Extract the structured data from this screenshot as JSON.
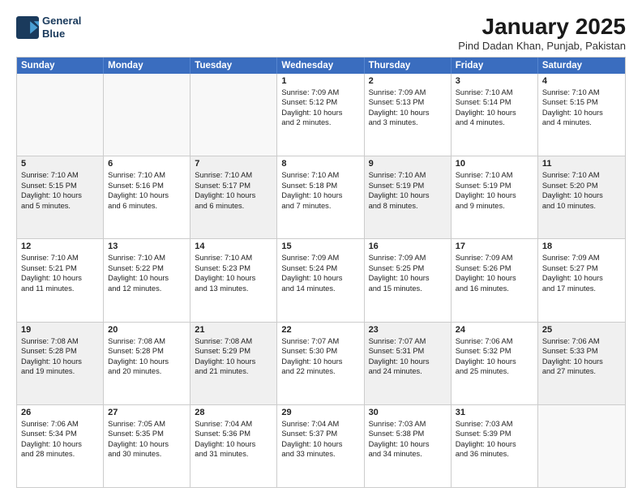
{
  "logo": {
    "line1": "General",
    "line2": "Blue"
  },
  "title": "January 2025",
  "location": "Pind Dadan Khan, Punjab, Pakistan",
  "header": {
    "days": [
      "Sunday",
      "Monday",
      "Tuesday",
      "Wednesday",
      "Thursday",
      "Friday",
      "Saturday"
    ]
  },
  "rows": [
    {
      "cells": [
        {
          "empty": true
        },
        {
          "empty": true
        },
        {
          "empty": true
        },
        {
          "num": "1",
          "lines": [
            "Sunrise: 7:09 AM",
            "Sunset: 5:12 PM",
            "Daylight: 10 hours",
            "and 2 minutes."
          ]
        },
        {
          "num": "2",
          "lines": [
            "Sunrise: 7:09 AM",
            "Sunset: 5:13 PM",
            "Daylight: 10 hours",
            "and 3 minutes."
          ]
        },
        {
          "num": "3",
          "lines": [
            "Sunrise: 7:10 AM",
            "Sunset: 5:14 PM",
            "Daylight: 10 hours",
            "and 4 minutes."
          ]
        },
        {
          "num": "4",
          "lines": [
            "Sunrise: 7:10 AM",
            "Sunset: 5:15 PM",
            "Daylight: 10 hours",
            "and 4 minutes."
          ]
        }
      ]
    },
    {
      "cells": [
        {
          "num": "5",
          "shaded": true,
          "lines": [
            "Sunrise: 7:10 AM",
            "Sunset: 5:15 PM",
            "Daylight: 10 hours",
            "and 5 minutes."
          ]
        },
        {
          "num": "6",
          "lines": [
            "Sunrise: 7:10 AM",
            "Sunset: 5:16 PM",
            "Daylight: 10 hours",
            "and 6 minutes."
          ]
        },
        {
          "num": "7",
          "shaded": true,
          "lines": [
            "Sunrise: 7:10 AM",
            "Sunset: 5:17 PM",
            "Daylight: 10 hours",
            "and 6 minutes."
          ]
        },
        {
          "num": "8",
          "lines": [
            "Sunrise: 7:10 AM",
            "Sunset: 5:18 PM",
            "Daylight: 10 hours",
            "and 7 minutes."
          ]
        },
        {
          "num": "9",
          "shaded": true,
          "lines": [
            "Sunrise: 7:10 AM",
            "Sunset: 5:19 PM",
            "Daylight: 10 hours",
            "and 8 minutes."
          ]
        },
        {
          "num": "10",
          "lines": [
            "Sunrise: 7:10 AM",
            "Sunset: 5:19 PM",
            "Daylight: 10 hours",
            "and 9 minutes."
          ]
        },
        {
          "num": "11",
          "shaded": true,
          "lines": [
            "Sunrise: 7:10 AM",
            "Sunset: 5:20 PM",
            "Daylight: 10 hours",
            "and 10 minutes."
          ]
        }
      ]
    },
    {
      "cells": [
        {
          "num": "12",
          "lines": [
            "Sunrise: 7:10 AM",
            "Sunset: 5:21 PM",
            "Daylight: 10 hours",
            "and 11 minutes."
          ]
        },
        {
          "num": "13",
          "shaded": false,
          "lines": [
            "Sunrise: 7:10 AM",
            "Sunset: 5:22 PM",
            "Daylight: 10 hours",
            "and 12 minutes."
          ]
        },
        {
          "num": "14",
          "lines": [
            "Sunrise: 7:10 AM",
            "Sunset: 5:23 PM",
            "Daylight: 10 hours",
            "and 13 minutes."
          ]
        },
        {
          "num": "15",
          "shaded": false,
          "lines": [
            "Sunrise: 7:09 AM",
            "Sunset: 5:24 PM",
            "Daylight: 10 hours",
            "and 14 minutes."
          ]
        },
        {
          "num": "16",
          "lines": [
            "Sunrise: 7:09 AM",
            "Sunset: 5:25 PM",
            "Daylight: 10 hours",
            "and 15 minutes."
          ]
        },
        {
          "num": "17",
          "shaded": false,
          "lines": [
            "Sunrise: 7:09 AM",
            "Sunset: 5:26 PM",
            "Daylight: 10 hours",
            "and 16 minutes."
          ]
        },
        {
          "num": "18",
          "lines": [
            "Sunrise: 7:09 AM",
            "Sunset: 5:27 PM",
            "Daylight: 10 hours",
            "and 17 minutes."
          ]
        }
      ]
    },
    {
      "cells": [
        {
          "num": "19",
          "shaded": true,
          "lines": [
            "Sunrise: 7:08 AM",
            "Sunset: 5:28 PM",
            "Daylight: 10 hours",
            "and 19 minutes."
          ]
        },
        {
          "num": "20",
          "lines": [
            "Sunrise: 7:08 AM",
            "Sunset: 5:28 PM",
            "Daylight: 10 hours",
            "and 20 minutes."
          ]
        },
        {
          "num": "21",
          "shaded": true,
          "lines": [
            "Sunrise: 7:08 AM",
            "Sunset: 5:29 PM",
            "Daylight: 10 hours",
            "and 21 minutes."
          ]
        },
        {
          "num": "22",
          "lines": [
            "Sunrise: 7:07 AM",
            "Sunset: 5:30 PM",
            "Daylight: 10 hours",
            "and 22 minutes."
          ]
        },
        {
          "num": "23",
          "shaded": true,
          "lines": [
            "Sunrise: 7:07 AM",
            "Sunset: 5:31 PM",
            "Daylight: 10 hours",
            "and 24 minutes."
          ]
        },
        {
          "num": "24",
          "lines": [
            "Sunrise: 7:06 AM",
            "Sunset: 5:32 PM",
            "Daylight: 10 hours",
            "and 25 minutes."
          ]
        },
        {
          "num": "25",
          "shaded": true,
          "lines": [
            "Sunrise: 7:06 AM",
            "Sunset: 5:33 PM",
            "Daylight: 10 hours",
            "and 27 minutes."
          ]
        }
      ]
    },
    {
      "cells": [
        {
          "num": "26",
          "lines": [
            "Sunrise: 7:06 AM",
            "Sunset: 5:34 PM",
            "Daylight: 10 hours",
            "and 28 minutes."
          ]
        },
        {
          "num": "27",
          "shaded": false,
          "lines": [
            "Sunrise: 7:05 AM",
            "Sunset: 5:35 PM",
            "Daylight: 10 hours",
            "and 30 minutes."
          ]
        },
        {
          "num": "28",
          "lines": [
            "Sunrise: 7:04 AM",
            "Sunset: 5:36 PM",
            "Daylight: 10 hours",
            "and 31 minutes."
          ]
        },
        {
          "num": "29",
          "shaded": false,
          "lines": [
            "Sunrise: 7:04 AM",
            "Sunset: 5:37 PM",
            "Daylight: 10 hours",
            "and 33 minutes."
          ]
        },
        {
          "num": "30",
          "lines": [
            "Sunrise: 7:03 AM",
            "Sunset: 5:38 PM",
            "Daylight: 10 hours",
            "and 34 minutes."
          ]
        },
        {
          "num": "31",
          "shaded": false,
          "lines": [
            "Sunrise: 7:03 AM",
            "Sunset: 5:39 PM",
            "Daylight: 10 hours",
            "and 36 minutes."
          ]
        },
        {
          "empty": true
        }
      ]
    }
  ]
}
